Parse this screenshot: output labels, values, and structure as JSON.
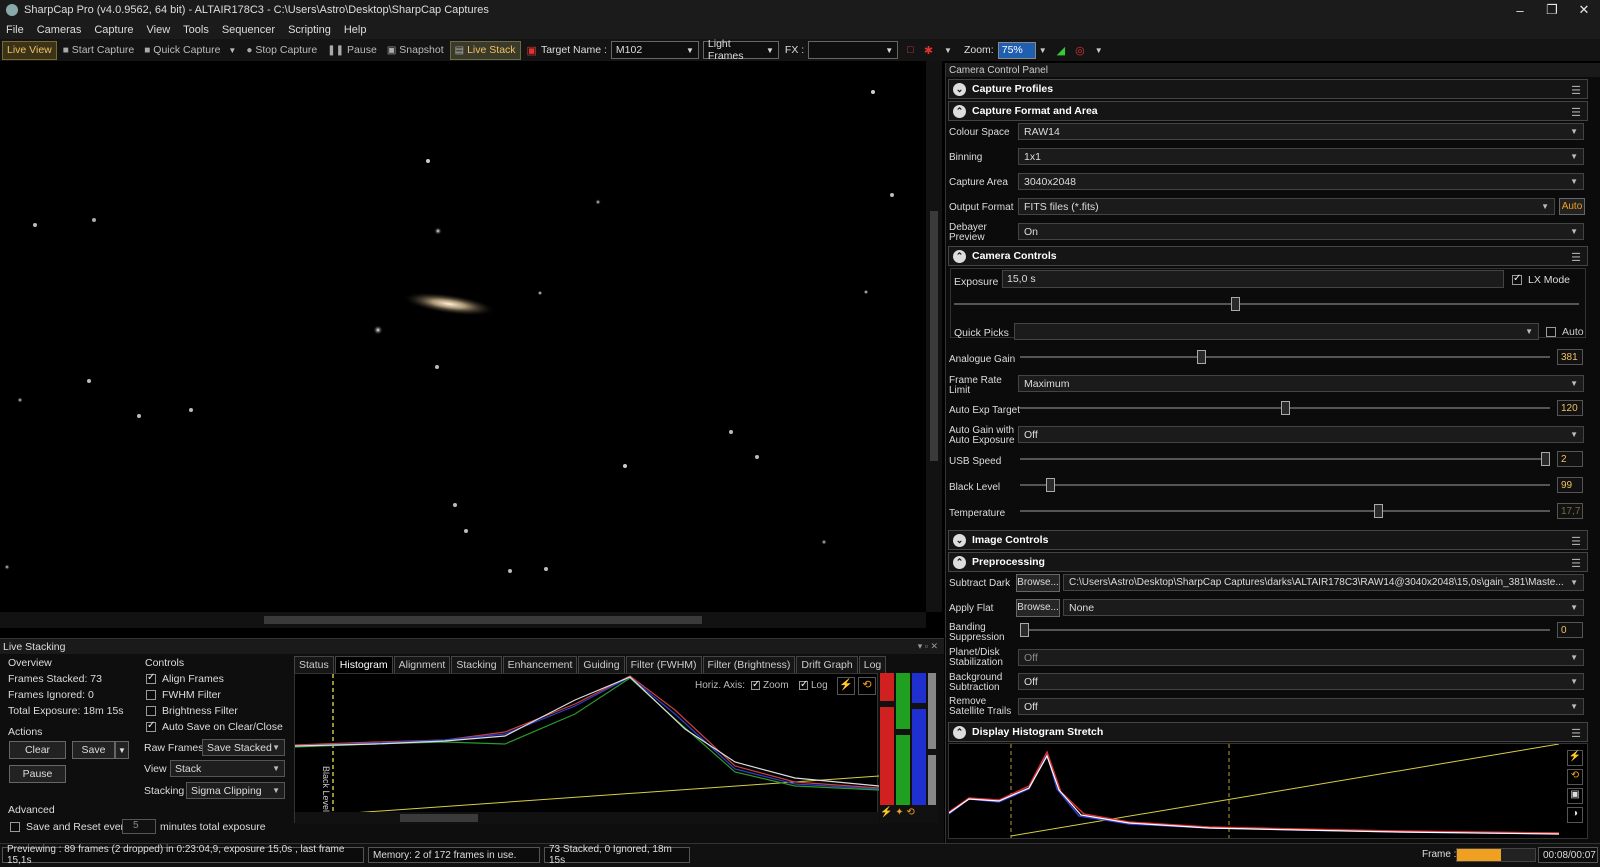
{
  "window": {
    "title": "SharpCap Pro (v4.0.9562, 64 bit) - ALTAIR178C3 - C:\\Users\\Astro\\Desktop\\SharpCap Captures",
    "minimize": "–",
    "restore": "❐",
    "close": "✕"
  },
  "menu": [
    "File",
    "Cameras",
    "Capture",
    "View",
    "Tools",
    "Sequencer",
    "Scripting",
    "Help"
  ],
  "toolbar": {
    "live_view": "Live View",
    "start_capture": "Start Capture",
    "quick_capture": "Quick Capture",
    "stop_capture": "Stop Capture",
    "pause": "Pause",
    "snapshot": "Snapshot",
    "live_stack": "Live Stack",
    "target_name_label": "Target Name :",
    "target_name": "M102",
    "frame_type": "Light Frames",
    "fx_label": "FX :",
    "fx_value": "",
    "zoom_label": "Zoom:",
    "zoom_value": "75%"
  },
  "live_stacking": {
    "title": "Live Stacking",
    "overview": {
      "title": "Overview",
      "frames_stacked": "Frames Stacked: 73",
      "frames_ignored": "Frames Ignored: 0",
      "total_exposure": "Total Exposure:   18m 15s"
    },
    "actions": {
      "title": "Actions",
      "clear": "Clear",
      "save": "Save",
      "pause": "Pause"
    },
    "advanced": {
      "title": "Advanced",
      "save_reset": "Save and Reset every",
      "minutes_value": "5",
      "minutes_label": "minutes total exposure"
    },
    "controls": {
      "title": "Controls",
      "align_frames": "Align Frames",
      "fwhm_filter": "FWHM Filter",
      "brightness_filter": "Brightness Filter",
      "auto_save": "Auto Save on Clear/Close",
      "raw_frames_label": "Raw Frames",
      "raw_frames_value": "Save Stacked",
      "view_label": "View",
      "view_value": "Stack",
      "stacking_label": "Stacking",
      "stacking_value": "Sigma Clipping"
    },
    "tabs": [
      "Status",
      "Histogram",
      "Alignment",
      "Stacking",
      "Enhancement",
      "Guiding",
      "Filter (FWHM)",
      "Filter (Brightness)",
      "Drift Graph",
      "Log"
    ],
    "selected_tab": "Histogram",
    "histogram": {
      "horiz_axis": "Horiz. Axis:",
      "zoom": "Zoom",
      "log": "Log",
      "black_level": "Black Level"
    }
  },
  "right_panel": {
    "title": "Camera Control Panel",
    "sections": {
      "capture_profiles": "Capture Profiles",
      "capture_format": "Capture Format and Area",
      "camera_controls": "Camera Controls",
      "image_controls": "Image Controls",
      "preprocessing": "Preprocessing",
      "display_histogram": "Display Histogram Stretch"
    },
    "format": {
      "colour_space_label": "Colour Space",
      "colour_space": "RAW14",
      "binning_label": "Binning",
      "binning": "1x1",
      "capture_area_label": "Capture Area",
      "capture_area": "3040x2048",
      "output_format_label": "Output Format",
      "output_format": "FITS files (*.fits)",
      "auto_btn": "Auto",
      "debayer_label": "Debayer Preview",
      "debayer": "On"
    },
    "camera": {
      "exposure_label": "Exposure",
      "exposure": "15,0 s",
      "lx_mode": "LX Mode",
      "exposure_level": 0.45,
      "quick_picks_label": "Quick Picks",
      "quick_auto": "Auto",
      "analogue_gain_label": "Analogue Gain",
      "analogue_gain": "381",
      "analogue_gain_level": 0.34,
      "frame_rate_label": "Frame Rate Limit",
      "frame_rate": "Maximum",
      "auto_exp_label": "Auto Exp Target",
      "auto_exp": "120",
      "auto_exp_level": 0.5,
      "auto_gain_label": "Auto Gain with Auto Exposure",
      "auto_gain": "Off",
      "usb_label": "USB Speed",
      "usb": "2",
      "usb_level": 1.0,
      "black_label": "Black Level",
      "black": "99",
      "black_level_level": 0.05,
      "temp_label": "Temperature",
      "temp": "17,7",
      "temp_level": 0.68
    },
    "pre": {
      "subtract_dark_label": "Subtract Dark",
      "browse": "Browse...",
      "subtract_dark": "C:\\Users\\Astro\\Desktop\\SharpCap Captures\\darks\\ALTAIR178C3\\RAW14@3040x2048\\15,0s\\gain_381\\Maste...",
      "apply_flat_label": "Apply Flat",
      "apply_flat": "None",
      "banding_label": "Banding Suppression",
      "banding": "0",
      "banding_level": 0.0,
      "planet_label": "Planet/Disk Stabilization",
      "planet": "Off",
      "bg_label": "Background Subtraction",
      "bg": "Off",
      "sat_label": "Remove Satellite Trails",
      "sat": "Off"
    }
  },
  "status": {
    "preview": "Previewing : 89 frames (2 dropped) in 0:23:04,9, exposure 15,0s , last frame 15,1s",
    "memory": "Memory: 2 of 172 frames in use.",
    "stacked": "73 Stacked, 0 Ignored, 18m 15s",
    "frame_label": "Frame :",
    "frame_count": "00:08/00:07"
  },
  "colors": {
    "accent": "#f0a020",
    "zoom_bg": "#1f5fb0",
    "hist_red": "#e53030",
    "hist_blue": "#3050e0",
    "hist_green": "#30c030"
  }
}
